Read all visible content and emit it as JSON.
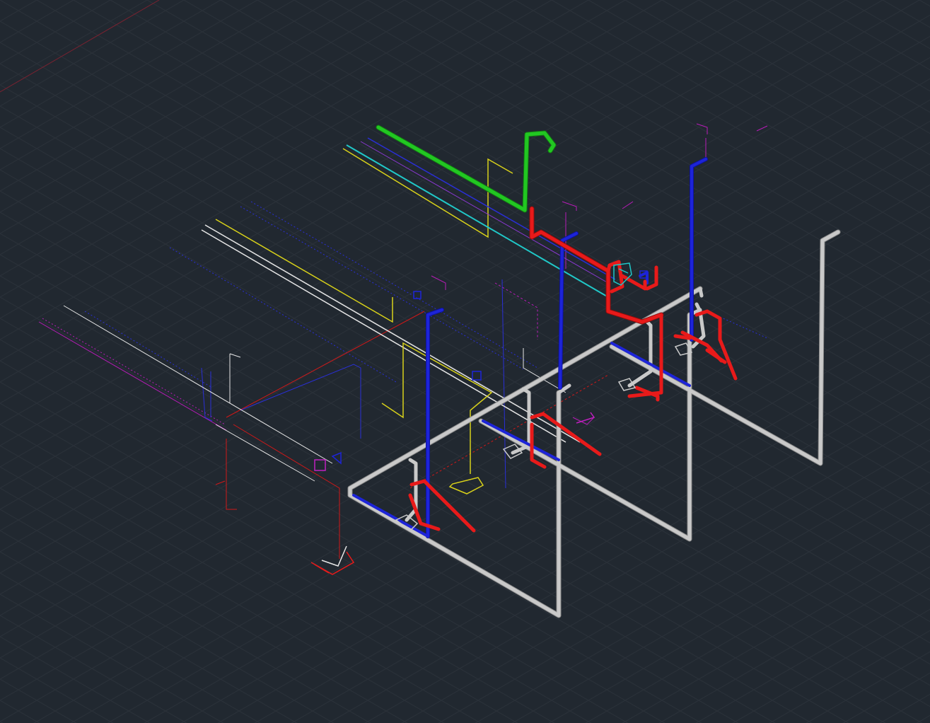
{
  "viewport": {
    "background": "#212830",
    "grid_color": "#2b323b",
    "axis_color": "#7a2230"
  },
  "colors": {
    "hot_water": "#e81a1a",
    "cold_water": "#1d24d8",
    "drain": "#c9c9c9",
    "vent": "#22c722",
    "gas": "#20c8c8",
    "aux_yellow": "#d8d11a",
    "aux_magenta": "#c020c0",
    "aux_white": "#e6e6e6"
  }
}
